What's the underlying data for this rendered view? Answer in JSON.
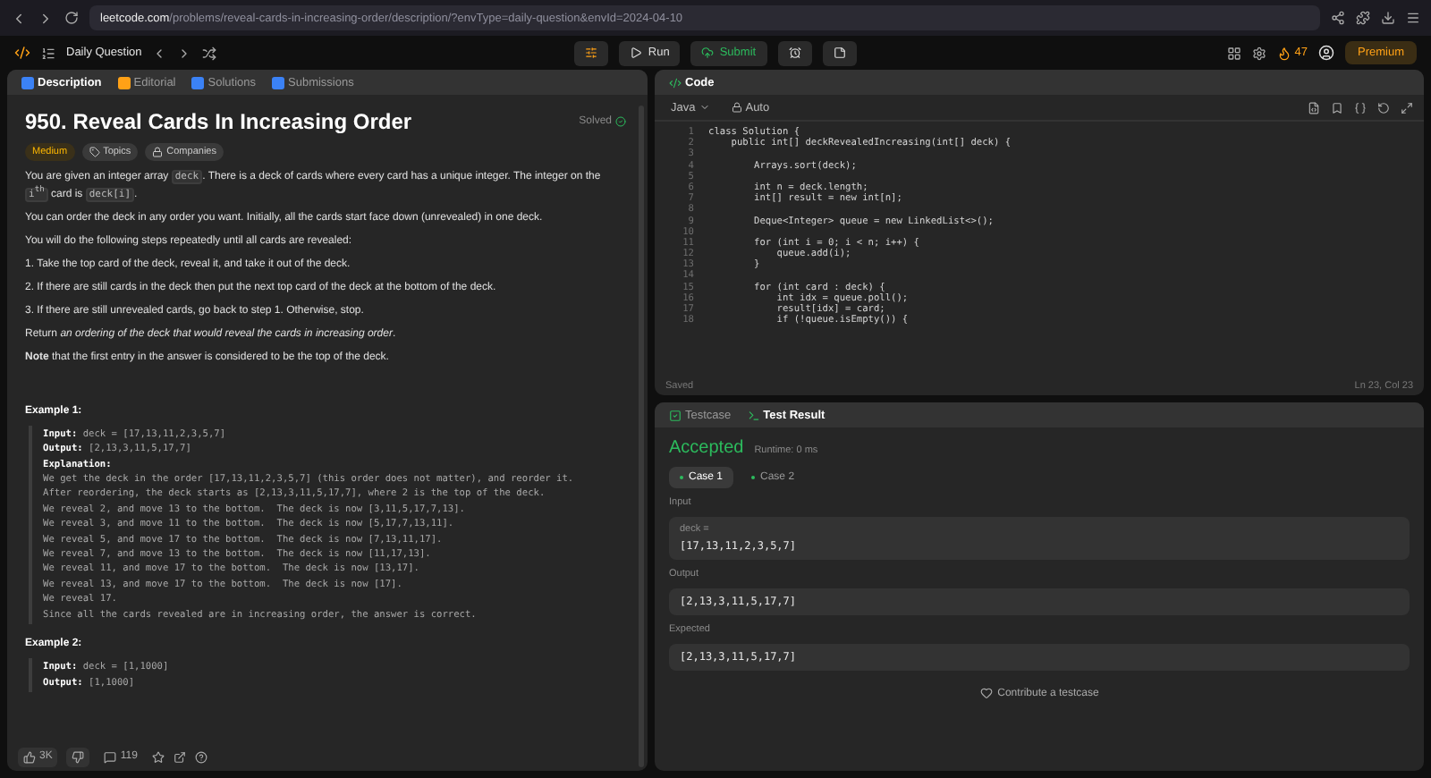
{
  "browser": {
    "url_host": "leetcode.com",
    "url_path": "/problems/reveal-cards-in-increasing-order/description/?envType=daily-question&envId=2024-04-10"
  },
  "nav": {
    "title": "Daily Question",
    "run": "Run",
    "submit": "Submit",
    "streak": "47",
    "premium": "Premium"
  },
  "description_tabs": [
    {
      "label": "Description",
      "selected": true,
      "color": "#3b82f6"
    },
    {
      "label": "Editorial",
      "selected": false,
      "color": "#ffa116"
    },
    {
      "label": "Solutions",
      "selected": false,
      "color": "#3b82f6"
    },
    {
      "label": "Submissions",
      "selected": false,
      "color": "#3b82f6"
    }
  ],
  "problem": {
    "title": "950. Reveal Cards In Increasing Order",
    "status": "Solved",
    "difficulty": "Medium",
    "tags": [
      "Topics",
      "Companies"
    ],
    "paragraphs": [
      {
        "kind": "plain",
        "parts": [
          {
            "kind": "text",
            "text": "You are given an integer array "
          },
          {
            "kind": "code",
            "text": "deck"
          },
          {
            "kind": "text",
            "text": ". There is a deck of cards where every card has a unique integer. The integer on the "
          },
          {
            "kind": "code",
            "text": "i$^{th}$"
          },
          {
            "kind": "text",
            "text": " card is "
          },
          {
            "kind": "code",
            "text": "deck[i]"
          },
          {
            "kind": "text",
            "text": "."
          }
        ]
      },
      {
        "kind": "plain",
        "parts": [
          {
            "kind": "text",
            "text": "You can order the deck in any order you want. Initially, all the cards start face down (unrevealed) in one deck."
          }
        ]
      },
      {
        "kind": "plain",
        "parts": [
          {
            "kind": "text",
            "text": "You will do the following steps repeatedly until all cards are revealed:"
          }
        ]
      },
      {
        "kind": "plain",
        "parts": [
          {
            "kind": "text",
            "text": "1. Take the top card of the deck, reveal it, and take it out of the deck."
          }
        ]
      },
      {
        "kind": "plain",
        "parts": [
          {
            "kind": "text",
            "text": "2. If there are still cards in the deck then put the next top card of the deck at the bottom of the deck."
          }
        ]
      },
      {
        "kind": "plain",
        "parts": [
          {
            "kind": "text",
            "text": "3. If there are still unrevealed cards, go back to step 1. Otherwise, stop."
          }
        ]
      },
      {
        "kind": "plain",
        "parts": [
          {
            "kind": "text",
            "text": "Return *an ordering of the deck that would reveal the cards in increasing order*."
          }
        ]
      },
      {
        "kind": "plain",
        "parts": [
          {
            "kind": "text",
            "text": "**Note** that the first entry in the answer is considered to be the top of the deck."
          }
        ]
      }
    ],
    "examples": [
      {
        "title": "Example 1:",
        "lines": [
          {
            "label": "Input:",
            "value": "deck = [17,13,11,2,3,5,7]"
          },
          {
            "label": "Output:",
            "value": "[2,13,3,11,5,17,7]"
          },
          {
            "label": "Explanation:"
          }
        ],
        "explanation": [
          "We get the deck in the order [17,13,11,2,3,5,7] (this order does not matter), and reorder it.",
          "After reordering, the deck starts as [2,13,3,11,5,17,7], where 2 is the top of the deck.",
          "We reveal 2, and move 13 to the bottom.  The deck is now [3,11,5,17,7,13].",
          "We reveal 3, and move 11 to the bottom.  The deck is now [5,17,7,13,11].",
          "We reveal 5, and move 17 to the bottom.  The deck is now [7,13,11,17].",
          "We reveal 7, and move 13 to the bottom.  The deck is now [11,17,13].",
          "We reveal 11, and move 17 to the bottom.  The deck is now [13,17].",
          "We reveal 13, and move 17 to the bottom.  The deck is now [17].",
          "We reveal 17.",
          "Since all the cards revealed are in increasing order, the answer is correct."
        ]
      },
      {
        "title": "Example 2:",
        "lines": [
          {
            "label": "Input:",
            "value": "deck = [1,1000]"
          },
          {
            "label": "Output:",
            "value": "[1,1000]"
          }
        ]
      }
    ],
    "likes": "3K",
    "comments": "119"
  },
  "code_panel": {
    "title": "Code",
    "language": "Java",
    "mode": "Auto",
    "status": "Saved",
    "cursor": "Ln 23, Col 23",
    "lines": [
      {
        "number": "1",
        "code": "class Solution {"
      },
      {
        "number": "2",
        "code": "    public int[] deckRevealedIncreasing(int[] deck) {"
      },
      {
        "number": "3"
      },
      {
        "number": "4",
        "code": "        Arrays.sort(deck);"
      },
      {
        "number": "5"
      },
      {
        "number": "6",
        "code": "        int n = deck.length;"
      },
      {
        "number": "7",
        "code": "        int[] result = new int[n];"
      },
      {
        "number": "8"
      },
      {
        "number": "9",
        "code": "        Deque<Integer> queue = new LinkedList<>();"
      },
      {
        "number": "10"
      },
      {
        "number": "11",
        "code": "        for (int i = 0; i < n; i++) {"
      },
      {
        "number": "12",
        "code": "            queue.add(i);"
      },
      {
        "number": "13",
        "code": "        }"
      },
      {
        "number": "14"
      },
      {
        "number": "15",
        "code": "        for (int card : deck) {"
      },
      {
        "number": "16",
        "code": "            int idx = queue.poll();"
      },
      {
        "number": "17",
        "code": "            result[idx] = card;"
      },
      {
        "number": "18",
        "code": "            if (!queue.isEmpty()) {"
      }
    ]
  },
  "test_panel": {
    "tabs": [
      {
        "label": "Testcase",
        "selected": false
      },
      {
        "label": "Test Result",
        "selected": true
      }
    ],
    "verdict": "Accepted",
    "runtime": "Runtime: 0 ms",
    "cases": [
      {
        "label": "Case 1",
        "selected": true
      },
      {
        "label": "Case 2",
        "selected": false
      }
    ],
    "sections": [
      {
        "title": "Input",
        "param": "deck =",
        "value": "[17,13,11,2,3,5,7]"
      },
      {
        "title": "Output",
        "value": "[2,13,3,11,5,17,7]"
      },
      {
        "title": "Expected",
        "value": "[2,13,3,11,5,17,7]"
      }
    ],
    "contribute": "Contribute a testcase"
  }
}
